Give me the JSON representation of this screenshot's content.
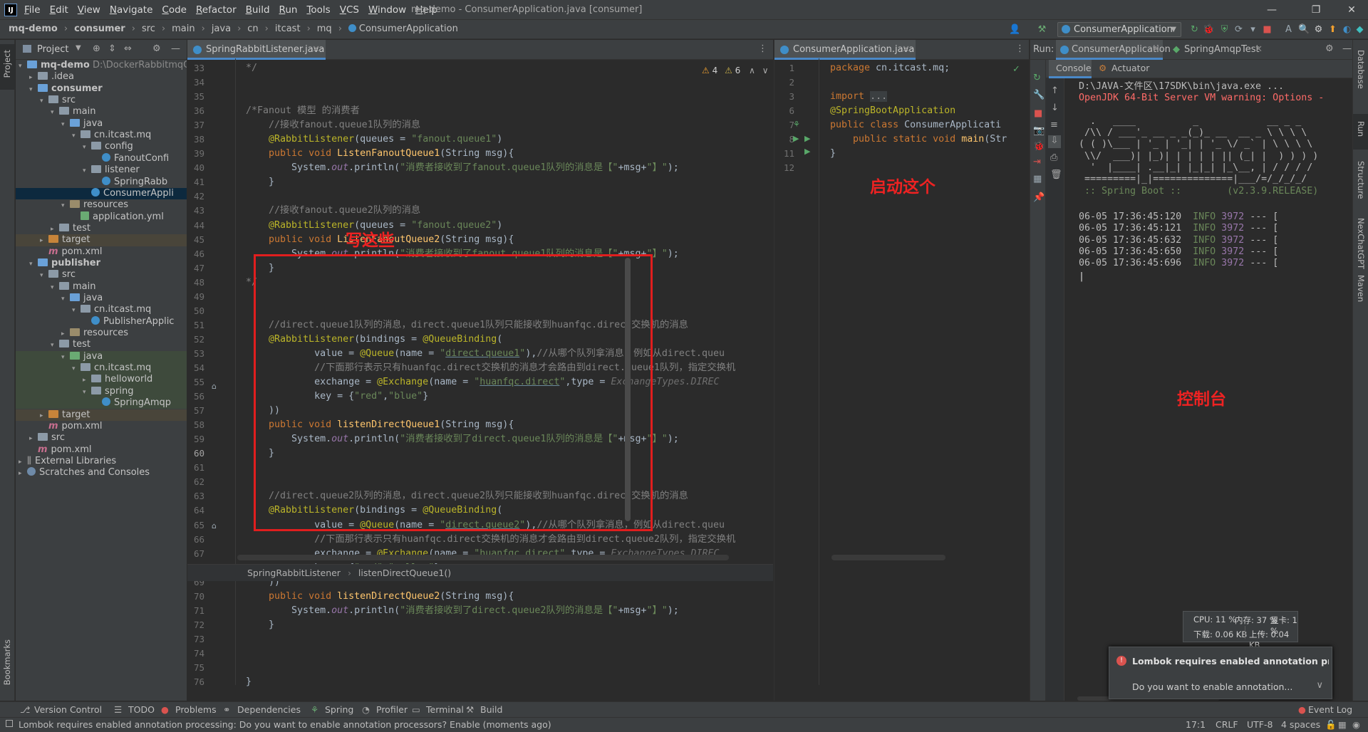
{
  "menubar": {
    "logo": "IJ",
    "items": [
      "File",
      "Edit",
      "View",
      "Navigate",
      "Code",
      "Refactor",
      "Build",
      "Run",
      "Tools",
      "VCS",
      "Window",
      "Help"
    ],
    "window_title": "mq-demo - ConsumerApplication.java [consumer]"
  },
  "breadcrumb": [
    "mq-demo",
    "consumer",
    "src",
    "main",
    "java",
    "cn",
    "itcast",
    "mq",
    "ConsumerApplication"
  ],
  "run_config": "ConsumerApplication",
  "left_stripe": {
    "project": "Project",
    "bookmarks": "Bookmarks"
  },
  "project_panel": {
    "title": "Project",
    "rows": [
      {
        "label": "mq-demo",
        "extra": "D:\\DockerRabbitmqCo",
        "indent": 0,
        "arrow": "▾",
        "icon": "folder-blue",
        "bold": true
      },
      {
        "label": ".idea",
        "indent": 1,
        "arrow": "▸",
        "icon": "folder-gray"
      },
      {
        "label": "consumer",
        "indent": 1,
        "arrow": "▾",
        "icon": "folder-blue",
        "bold": true
      },
      {
        "label": "src",
        "indent": 2,
        "arrow": "▾",
        "icon": "folder-gray"
      },
      {
        "label": "main",
        "indent": 3,
        "arrow": "▾",
        "icon": "folder-gray"
      },
      {
        "label": "java",
        "indent": 4,
        "arrow": "▾",
        "icon": "folder-blue"
      },
      {
        "label": "cn.itcast.mq",
        "indent": 5,
        "arrow": "▾",
        "icon": "folder-gray"
      },
      {
        "label": "config",
        "indent": 6,
        "arrow": "▾",
        "icon": "folder-gray"
      },
      {
        "label": "FanoutConfi",
        "indent": 7,
        "arrow": "",
        "icon": "class"
      },
      {
        "label": "listener",
        "indent": 6,
        "arrow": "▾",
        "icon": "folder-gray"
      },
      {
        "label": "SpringRabb",
        "indent": 7,
        "arrow": "",
        "icon": "class"
      },
      {
        "label": "ConsumerAppli",
        "indent": 6,
        "arrow": "",
        "icon": "spring-class",
        "selected": true
      },
      {
        "label": "resources",
        "indent": 4,
        "arrow": "▾",
        "icon": "folder-res"
      },
      {
        "label": "application.yml",
        "indent": 5,
        "arrow": "",
        "icon": "yml"
      },
      {
        "label": "test",
        "indent": 3,
        "arrow": "▸",
        "icon": "folder-gray"
      },
      {
        "label": "target",
        "indent": 2,
        "arrow": "▸",
        "icon": "folder-orange",
        "shade": "orange"
      },
      {
        "label": "pom.xml",
        "indent": 2,
        "arrow": "",
        "icon": "maven"
      },
      {
        "label": "publisher",
        "indent": 1,
        "arrow": "▾",
        "icon": "folder-blue",
        "bold": true
      },
      {
        "label": "src",
        "indent": 2,
        "arrow": "▾",
        "icon": "folder-gray"
      },
      {
        "label": "main",
        "indent": 3,
        "arrow": "▾",
        "icon": "folder-gray"
      },
      {
        "label": "java",
        "indent": 4,
        "arrow": "▾",
        "icon": "folder-blue"
      },
      {
        "label": "cn.itcast.mq",
        "indent": 5,
        "arrow": "▾",
        "icon": "folder-gray"
      },
      {
        "label": "PublisherApplic",
        "indent": 6,
        "arrow": "",
        "icon": "spring-class"
      },
      {
        "label": "resources",
        "indent": 4,
        "arrow": "▸",
        "icon": "folder-res"
      },
      {
        "label": "test",
        "indent": 3,
        "arrow": "▾",
        "icon": "folder-gray"
      },
      {
        "label": "java",
        "indent": 4,
        "arrow": "▾",
        "icon": "folder-green",
        "shade": "green"
      },
      {
        "label": "cn.itcast.mq",
        "indent": 5,
        "arrow": "▾",
        "icon": "folder-gray",
        "shade": "green"
      },
      {
        "label": "helloworld",
        "indent": 6,
        "arrow": "▸",
        "icon": "folder-gray",
        "shade": "green"
      },
      {
        "label": "spring",
        "indent": 6,
        "arrow": "▾",
        "icon": "folder-gray",
        "shade": "green"
      },
      {
        "label": "SpringAmqp",
        "indent": 7,
        "arrow": "",
        "icon": "class",
        "shade": "green"
      },
      {
        "label": "target",
        "indent": 2,
        "arrow": "▸",
        "icon": "folder-orange",
        "shade": "orange"
      },
      {
        "label": "pom.xml",
        "indent": 2,
        "arrow": "",
        "icon": "maven"
      },
      {
        "label": "src",
        "indent": 1,
        "arrow": "▸",
        "icon": "folder-gray"
      },
      {
        "label": "pom.xml",
        "indent": 1,
        "arrow": "",
        "icon": "maven"
      },
      {
        "label": "External Libraries",
        "indent": 0,
        "arrow": "▸",
        "icon": "library"
      },
      {
        "label": "Scratches and Consoles",
        "indent": 0,
        "arrow": "▸",
        "icon": "scratch"
      }
    ]
  },
  "editor1": {
    "tab": "SpringRabbitListener.java",
    "warnings": "4",
    "weak_warnings": "6",
    "line_numbers": [
      "33",
      "34",
      "35",
      "36",
      "37",
      "38",
      "39",
      "40",
      "41",
      "42",
      "43",
      "44",
      "45",
      "46",
      "47",
      "48",
      "49",
      "50",
      "51",
      "52",
      "53",
      "54",
      "55",
      "56",
      "57",
      "58",
      "59",
      "60",
      "61",
      "62",
      "63",
      "64",
      "65",
      "66",
      "67",
      "68",
      "69",
      "70",
      "71",
      "72",
      "73",
      "74",
      "75",
      "76"
    ],
    "code": [
      "*/",
      "",
      "",
      "/*Fanout 模型 的消费者",
      "    //接收fanout.queue1队列的消息",
      "    @RabbitListener(queues = \"fanout.queue1\")",
      "    public void ListenFanoutQueue1(String msg){",
      "        System.out.println(\"消费者接收到了fanout.queue1队列的消息是【\"+msg+\"】\");",
      "    }",
      "",
      "    //接收fanout.queue2队列的消息",
      "    @RabbitListener(queues = \"fanout.queue2\")",
      "    public void ListenFanoutQueue2(String msg){",
      "        System.out.println(\"消费者接收到了fanout.queue1队列的消息是【\"+msg+\"】\");",
      "    }",
      "*/",
      "",
      "",
      "    //direct.queue1队列的消息，direct.queue1队列只能接收到huanfqc.direct交换机的消息",
      "    @RabbitListener(bindings = @QueueBinding(",
      "            value = @Queue(name = \"direct.queue1\"),//从哪个队列拿消息，例如从direct.queu",
      "            //下面那行表示只有huanfqc.direct交换机的消息才会路由到direct.queue1队列，指定交换机",
      "            exchange = @Exchange(name = \"huanfqc.direct\",type = ExchangeTypes.DIREC",
      "            key = {\"red\",\"blue\"}",
      "    ))",
      "    public void listenDirectQueue1(String msg){",
      "        System.out.println(\"消费者接收到了direct.queue1队列的消息是【\"+msg+\"】\");",
      "    }",
      "",
      "",
      "    //direct.queue2队列的消息，direct.queue2队列只能接收到huanfqc.direct交换机的消息",
      "    @RabbitListener(bindings = @QueueBinding(",
      "            value = @Queue(name = \"direct.queue2\"),//从哪个队列拿消息，例如从direct.queu",
      "            //下面那行表示只有huanfqc.direct交换机的消息才会路由到direct.queue2队列，指定交换机",
      "            exchange = @Exchange(name = \"huanfqc.direct\",type = ExchangeTypes.DIREC",
      "            key = {\"red\",\"yellow\"}",
      "    ))",
      "    public void listenDirectQueue2(String msg){",
      "        System.out.println(\"消费者接收到了direct.queue2队列的消息是【\"+msg+\"】\");",
      "    }",
      "",
      "",
      "",
      "}"
    ],
    "annotation_write": "写这些",
    "breadcrumb_class": "SpringRabbitListener",
    "breadcrumb_method": "listenDirectQueue1()"
  },
  "editor2": {
    "tab": "ConsumerApplication.java",
    "line_numbers": [
      "1",
      "2",
      "3",
      "6",
      "7",
      "8",
      "11",
      "12"
    ],
    "code": [
      "package cn.itcast.mq;",
      "",
      "import ...",
      "@SpringBootApplication",
      "public class ConsumerApplicati",
      "    public static void main(Str",
      "}",
      ""
    ],
    "annotation_start": "启动这个"
  },
  "run_panel": {
    "label": "Run:",
    "tabs": [
      "ConsumerApplication",
      "SpringAmqpTest"
    ],
    "subtabs": [
      "Console",
      "Actuator"
    ],
    "console_lines": [
      "D:\\JAVA-文件区\\17SDK\\bin\\java.exe ...",
      "OpenJDK 64-Bit Server VM warning: Options -",
      "",
      "  .   ____          _            __ _ _",
      " /\\\\ / ___'_ __ _ _(_)_ __  __ _ \\ \\ \\ \\",
      "( ( )\\___ | '_ | '_| | '_ \\/ _` | \\ \\ \\ \\",
      " \\\\/  ___)| |_)| | | | | || (_| |  ) ) ) )",
      "  '  |____| .__|_| |_|_| |_\\__, | / / / /",
      " =========|_|==============|___/=/_/_/_/",
      " :: Spring Boot ::        (v2.3.9.RELEASE)"
    ],
    "log_lines": [
      {
        "time": "06-05 17:36:45:120",
        "level": "INFO",
        "pid": "3972",
        "rest": "--- ["
      },
      {
        "time": "06-05 17:36:45:121",
        "level": "INFO",
        "pid": "3972",
        "rest": "--- ["
      },
      {
        "time": "06-05 17:36:45:632",
        "level": "INFO",
        "pid": "3972",
        "rest": "--- ["
      },
      {
        "time": "06-05 17:36:45:650",
        "level": "INFO",
        "pid": "3972",
        "rest": "--- ["
      },
      {
        "time": "06-05 17:36:45:696",
        "level": "INFO",
        "pid": "3972",
        "rest": "--- ["
      }
    ],
    "annotation_console": "控制台"
  },
  "perf_widget": {
    "cpu": "CPU: 11 %",
    "mem": "内存: 37 %",
    "gpu": "显卡: 1 %",
    "down": "下载: 0.06 KB",
    "up": "上传: 0.04 KB"
  },
  "notification": {
    "title": "Lombok requires enabled annotation process",
    "action": "Do you want to enable annotation..."
  },
  "right_stripe": [
    "Database",
    "Run",
    "Structure",
    "NexChatGPT",
    "Maven"
  ],
  "bottom_tools": [
    "Version Control",
    "TODO",
    "Problems",
    "Dependencies",
    "Spring",
    "Profiler",
    "Terminal",
    "Build"
  ],
  "event_log": "Event Log",
  "status": {
    "message": "Lombok requires enabled annotation processing: Do you want to enable annotation processors? Enable (moments ago)",
    "position": "17:1",
    "line_sep": "CRLF",
    "encoding": "UTF-8",
    "indent": "4 spaces"
  },
  "colors": {
    "accent": "#4a88c7",
    "annotation_red": "#ee2222",
    "console_error": "#ff6b68",
    "info_green": "#6a8759"
  }
}
